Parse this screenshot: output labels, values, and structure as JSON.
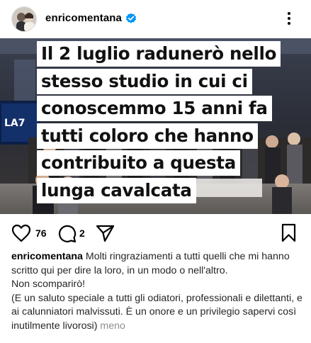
{
  "post": {
    "username": "enricomentana",
    "verified": true,
    "image_text_lines": [
      "Il 2 luglio radunerò nello",
      "stesso studio in cui ci",
      "conoscemmo 15 anni fa",
      "tutti coloro che hanno",
      "contribuito a questa",
      "lunga cavalcata"
    ],
    "likes_count": "76",
    "comments_count": "2",
    "caption": {
      "line1": "Molti ringraziamenti a tutti quelli che mi hanno scritto qui per dire la loro, in un modo o nell'altro.",
      "line2": "Non scomparirò!",
      "line3": "(E un saluto speciale a tutti gli odiatori, professionali e dilettanti, e ai calunniatori malvissuti. È un onore e un privilegio sapervi così inutilmente livorosi)",
      "more_label": "meno"
    }
  },
  "colors": {
    "verified_blue": "#0095f6",
    "muted": "#8e8e8e",
    "logo_text": "LA7"
  }
}
